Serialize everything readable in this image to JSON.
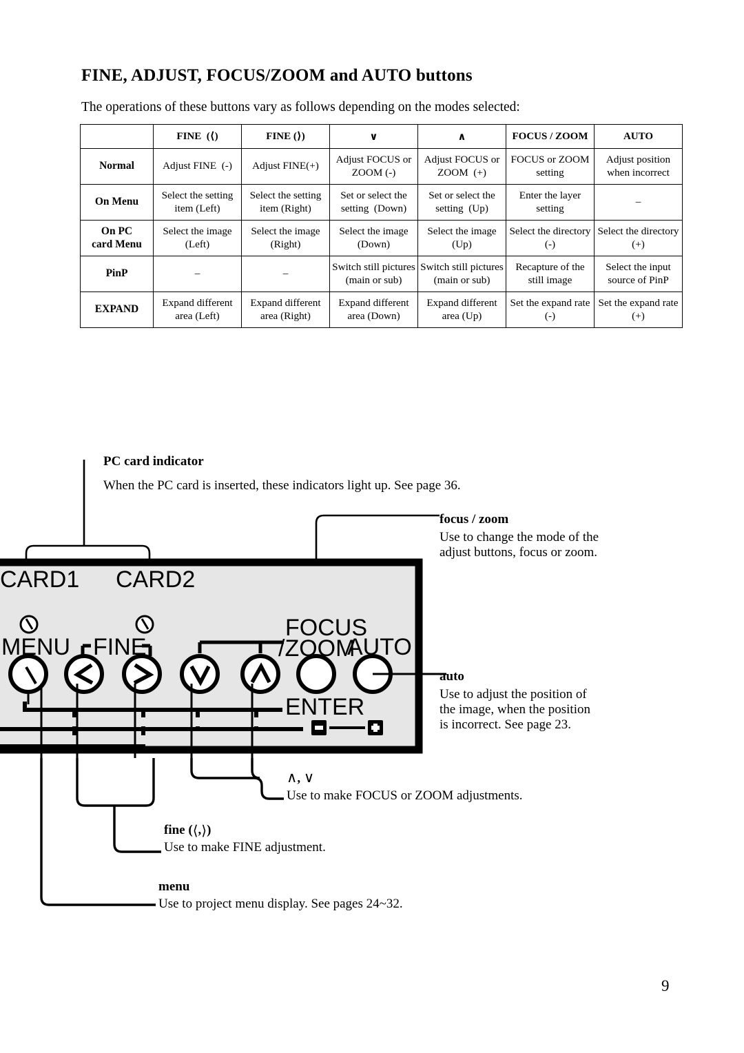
{
  "page": {
    "title": "FINE, ADJUST, FOCUS/ZOOM and AUTO buttons",
    "intro": "The operations of these buttons vary as follows depending on the modes selected:",
    "number": "9"
  },
  "table": {
    "headers": [
      {
        "label": "",
        "glyph": ""
      },
      {
        "label": "FINE",
        "glyph": "⟨",
        "suffix": ""
      },
      {
        "label": "FINE",
        "glyph": "⟩",
        "suffix": ""
      },
      {
        "label": "",
        "glyph": "∨"
      },
      {
        "label": "",
        "glyph": "∧"
      },
      {
        "label": "FOCUS / ZOOM",
        "glyph": ""
      },
      {
        "label": "AUTO",
        "glyph": ""
      }
    ],
    "header_texts": {
      "blank": "",
      "fine_left": "FINE (⟨)",
      "fine_right": "FINE (⟩)",
      "down": "∨",
      "up": "∧",
      "focus_zoom": "FOCUS / ZOOM",
      "auto": "AUTO"
    },
    "rows": [
      {
        "mode": "Normal",
        "cells": [
          "Adjust FINE (-)",
          "Adjust FINE(+)",
          "Adjust FOCUS or ZOOM (-)",
          "Adjust FOCUS or ZOOM (+)",
          "FOCUS or ZOOM setting",
          "Adjust position when incorrect"
        ]
      },
      {
        "mode": "On Menu",
        "cells": [
          "Select the setting item (Left)",
          "Select the setting item (Right)",
          "Set or select the setting (Down)",
          "Set or select the setting (Up)",
          "Enter the layer setting",
          "–"
        ]
      },
      {
        "mode": "On PC card Menu",
        "mode_line1": "On PC",
        "mode_line2": "card Menu",
        "cells": [
          "Select the image (Left)",
          "Select the image (Right)",
          "Select the image (Down)",
          "Select the image (Up)",
          "Select the directory (-)",
          "Select the directory (+)"
        ]
      },
      {
        "mode": "PinP",
        "cells": [
          "–",
          "–",
          "Switch still pictures (main or sub)",
          "Switch still pictures (main or sub)",
          "Recapture of the still image",
          "Select the input source of PinP"
        ]
      },
      {
        "mode": "EXPAND",
        "cells": [
          "Expand different area (Left)",
          "Expand different area (Right)",
          "Expand different area (Down)",
          "Expand different area (Up)",
          "Set the expand rate (-)",
          "Set the expand rate (+)"
        ]
      }
    ]
  },
  "callouts": {
    "pc_card_indicator": {
      "title": "PC card indicator",
      "body": "When the PC card is inserted, these indicators light up. See page 36."
    },
    "focus_zoom": {
      "title": "focus / zoom",
      "body_line1": "Use to change the mode of the",
      "body_line2": "adjust buttons, focus or zoom."
    },
    "auto": {
      "title": "auto",
      "body_line1": "Use to adjust the position of",
      "body_line2": "the image, when the position",
      "body_line3": "is incorrect. See page 23."
    },
    "up_down": {
      "title_glyph_up": "∧",
      "title_sep": ",",
      "title_glyph_down": "∨",
      "body": "Use to make FOCUS or ZOOM adjustments."
    },
    "fine": {
      "title_label": "fine",
      "title_glyph_left": "⟨",
      "title_sep": ",",
      "title_glyph_right": "⟩",
      "body": "Use to make FINE adjustment."
    },
    "menu": {
      "title": "menu",
      "body": "Use to project menu display. See pages 24~32."
    }
  },
  "panel": {
    "card1_label": "CARD1",
    "card2_label": "CARD2",
    "menu_label": "MENU",
    "fine_label": "FINE",
    "focus_zoom_label_line1": "FOCUS",
    "focus_zoom_label_line2": "/ZOOM",
    "auto_label": "AUTO",
    "enter_label": "ENTER",
    "minus_glyph": "−",
    "plus_glyph": "+",
    "buttons": [
      {
        "name": "menu",
        "glyph": ""
      },
      {
        "name": "fine-left",
        "glyph": "⟨"
      },
      {
        "name": "fine-right",
        "glyph": "⟩"
      },
      {
        "name": "adjust-down",
        "glyph": "∨"
      },
      {
        "name": "adjust-up",
        "glyph": "∧"
      },
      {
        "name": "focus-zoom",
        "glyph": ""
      },
      {
        "name": "auto",
        "glyph": ""
      }
    ],
    "colors": {
      "panel_fill": "#e6e6e6",
      "outline": "#000000"
    }
  }
}
